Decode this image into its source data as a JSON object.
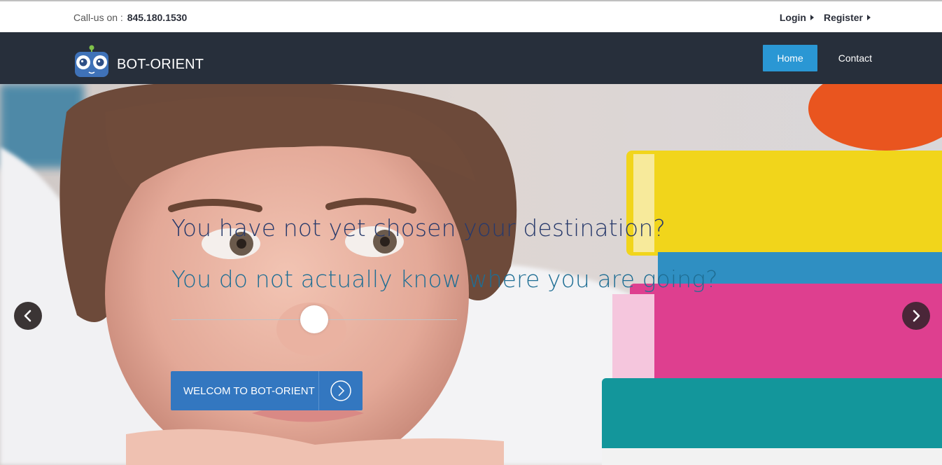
{
  "topbar": {
    "callus_label": "Call-us on :",
    "phone": "845.180.1530",
    "login": "Login",
    "register": "Register"
  },
  "navbar": {
    "brand_name": "BOT-ORIENT",
    "menu": [
      {
        "label": "Home",
        "active": true
      },
      {
        "label": "Contact",
        "active": false
      }
    ]
  },
  "hero": {
    "headline_1": "You have not yet chosen your destination?",
    "headline_2": "You do not actually know where you are going?",
    "cta_label": "WELCOM TO BOT-ORIENT"
  },
  "icons": {
    "logo": "robot-logo-icon",
    "prev": "chevron-left-icon",
    "next": "chevron-right-icon",
    "cta": "circle-chevron-right-icon"
  },
  "colors": {
    "navbar_bg": "#272f3b",
    "accent": "#2a97d4",
    "cta_bg": "#3377c0",
    "headline_1": "#283a6b",
    "headline_2": "#1f6e94"
  }
}
